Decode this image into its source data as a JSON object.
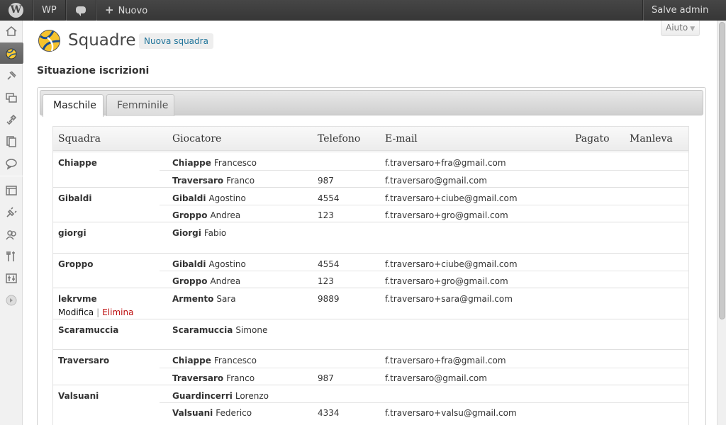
{
  "adminbar": {
    "site_label": "WP",
    "new_label": "Nuovo",
    "account_label": "Salve admin",
    "icons": [
      "wordpress-logo-icon",
      "comment-bubble-icon",
      "plus-icon"
    ]
  },
  "header": {
    "title": "Squadre",
    "add_new": "Nuova squadra",
    "help": "Aiuto",
    "section": "Situazione iscrizioni"
  },
  "tabs": [
    {
      "label": "Maschile",
      "active": true
    },
    {
      "label": "Femminile",
      "active": false
    }
  ],
  "table": {
    "columns": [
      "Squadra",
      "Giocatore",
      "Telefono",
      "E-mail",
      "Pagato",
      "Manleva"
    ],
    "teams": [
      {
        "team": "Chiappe",
        "players": [
          {
            "surname": "Chiappe",
            "name": "Francesco",
            "phone": "",
            "email": "f.traversaro+fra@gmail.com"
          },
          {
            "surname": "Traversaro",
            "name": "Franco",
            "phone": "987",
            "email": "f.traversaro@gmail.com"
          }
        ]
      },
      {
        "team": "Gibaldi",
        "players": [
          {
            "surname": "Gibaldi",
            "name": "Agostino",
            "phone": "4554",
            "email": "f.traversaro+ciube@gmail.com"
          },
          {
            "surname": "Groppo",
            "name": "Andrea",
            "phone": "123",
            "email": "f.traversaro+gro@gmail.com"
          }
        ]
      },
      {
        "team": "giorgi",
        "players": [
          {
            "surname": "Giorgi",
            "name": "Fabio",
            "phone": "",
            "email": ""
          }
        ]
      },
      {
        "team": "Groppo",
        "players": [
          {
            "surname": "Gibaldi",
            "name": "Agostino",
            "phone": "4554",
            "email": "f.traversaro+ciube@gmail.com"
          },
          {
            "surname": "Groppo",
            "name": "Andrea",
            "phone": "123",
            "email": "f.traversaro+gro@gmail.com"
          }
        ]
      },
      {
        "team": "lekrvme",
        "actions": {
          "edit": "Modifica",
          "separator": "|",
          "delete": "Elimina"
        },
        "players": [
          {
            "surname": "Armento",
            "name": "Sara",
            "phone": "9889",
            "email": "f.traversaro+sara@gmail.com"
          }
        ]
      },
      {
        "team": "Scaramuccia",
        "players": [
          {
            "surname": "Scaramuccia",
            "name": "Simone",
            "phone": "",
            "email": ""
          }
        ]
      },
      {
        "team": "Traversaro",
        "players": [
          {
            "surname": "Chiappe",
            "name": "Francesco",
            "phone": "",
            "email": "f.traversaro+fra@gmail.com"
          },
          {
            "surname": "Traversaro",
            "name": "Franco",
            "phone": "987",
            "email": "f.traversaro@gmail.com"
          }
        ]
      },
      {
        "team": "Valsuani",
        "players": [
          {
            "surname": "Guardincerri",
            "name": "Lorenzo",
            "phone": "",
            "email": ""
          },
          {
            "surname": "Valsuani",
            "name": "Federico",
            "phone": "4334",
            "email": "f.traversaro+valsu@gmail.com"
          }
        ]
      }
    ]
  },
  "colors": {
    "link": "#21759b",
    "delete": "#bc0b0b",
    "adminbar": "#464646"
  }
}
